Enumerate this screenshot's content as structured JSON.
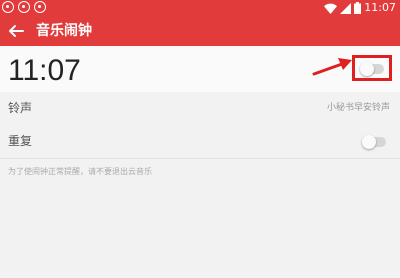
{
  "status_bar": {
    "time": "11:07",
    "icons": [
      "netease-cloud-music-icon",
      "netease-cloud-music-icon",
      "netease-cloud-music-icon",
      "wifi-icon",
      "signal-icon",
      "battery-icon"
    ]
  },
  "app_bar": {
    "back_icon": "arrow-left-icon",
    "title": "音乐闹钟",
    "background_color": "#e23b3b"
  },
  "alarm": {
    "time": "11:07",
    "enabled": false
  },
  "settings": {
    "ringtone_label": "铃声",
    "ringtone_value": "小秘书早安铃声",
    "repeat_label": "重复",
    "repeat_enabled": false
  },
  "hint": "为了使闹钟正常提醒，请不要退出云音乐",
  "annotation": {
    "color": "#e02020"
  }
}
